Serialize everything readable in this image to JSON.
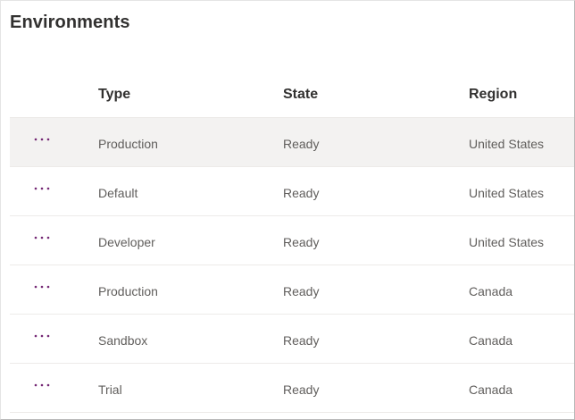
{
  "page": {
    "title": "Environments"
  },
  "table": {
    "columns": {
      "type": "Type",
      "state": "State",
      "region": "Region"
    },
    "rows": [
      {
        "type": "Production",
        "state": "Ready",
        "region": "United States"
      },
      {
        "type": "Default",
        "state": "Ready",
        "region": "United States"
      },
      {
        "type": "Developer",
        "state": "Ready",
        "region": "United States"
      },
      {
        "type": "Production",
        "state": "Ready",
        "region": "Canada"
      },
      {
        "type": "Sandbox",
        "state": "Ready",
        "region": "Canada"
      },
      {
        "type": "Trial",
        "state": "Ready",
        "region": "Canada"
      }
    ],
    "more_icon": "more-horizontal-icon"
  },
  "colors": {
    "accent": "#742774",
    "hover_row": "#f3f2f1",
    "divider": "#edebe9"
  }
}
